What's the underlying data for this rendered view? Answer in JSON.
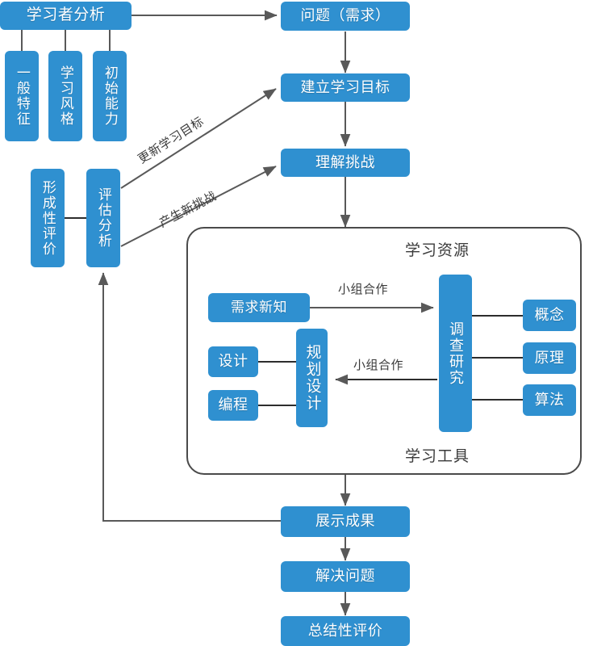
{
  "diagram": {
    "title_nodes": {
      "learner_analysis": "学习者分析",
      "general_traits": "一般特征",
      "learning_style": "学习风格",
      "initial_ability": "初始能力",
      "formative_evaluation": "形成性评价",
      "assessment_analysis": "评估分析",
      "problem_need": "问题（需求）",
      "establish_goal": "建立学习目标",
      "understand_challenge": "理解挑战",
      "demand_new_knowledge": "需求新知",
      "design": "设计",
      "programming": "编程",
      "plan_design": "规划设计",
      "investigate_research": "调查研究",
      "concept": "概念",
      "principle": "原理",
      "algorithm": "算法",
      "show_results": "展示成果",
      "solve_problem": "解决问题",
      "summative_evaluation": "总结性评价"
    },
    "panel_labels": {
      "learning_resources": "学习资源",
      "learning_tools": "学习工具"
    },
    "edge_labels": {
      "update_goal": "更新学习目标",
      "generate_challenge": "产生新挑战",
      "group_cooperation_top": "小组合作",
      "group_cooperation_bottom": "小组合作"
    },
    "colors": {
      "node_fill": "#2f90d0",
      "node_text": "#ffffff",
      "edge_stroke": "#595959",
      "panel_stroke": "#4a4a4a",
      "label_text": "#3a3a3a",
      "background": "#ffffff"
    }
  }
}
